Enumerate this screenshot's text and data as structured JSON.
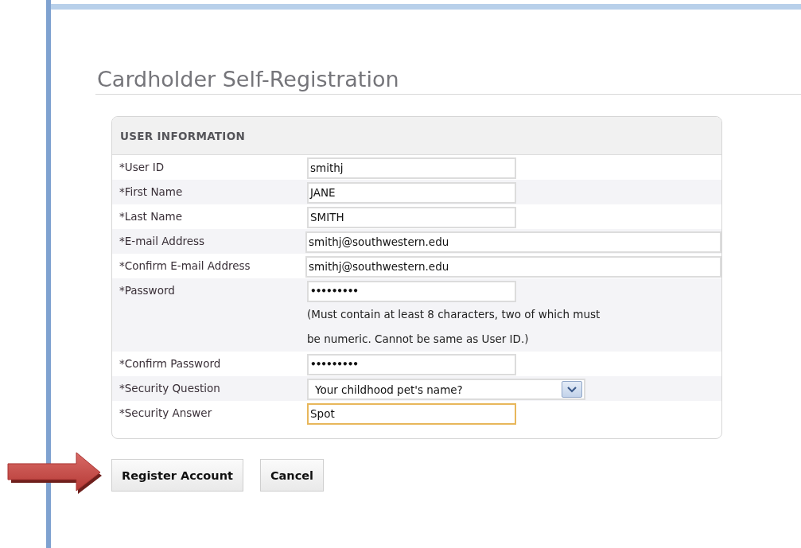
{
  "title": "Cardholder Self-Registration",
  "section": {
    "heading": "USER INFORMATION",
    "fields": [
      {
        "label": "*User ID",
        "kind": "text",
        "value": "smithj",
        "focused": false
      },
      {
        "label": "*First Name",
        "kind": "text",
        "value": "JANE",
        "focused": false
      },
      {
        "label": "*Last Name",
        "kind": "text",
        "value": "SMITH",
        "focused": false
      },
      {
        "label": "*E-mail Address",
        "kind": "email",
        "value": "smithj@southwestern.edu",
        "focused": false
      },
      {
        "label": "*Confirm E-mail Address",
        "kind": "email",
        "value": "smithj@southwestern.edu",
        "focused": false
      },
      {
        "label": "*Password",
        "kind": "password",
        "value": "•••••••••",
        "focused": false,
        "hint": [
          "(Must contain at least 8 characters, two of which must",
          "be numeric. Cannot be same as User ID.)"
        ]
      },
      {
        "label": "*Confirm Password",
        "kind": "password",
        "value": "•••••••••",
        "focused": false
      },
      {
        "label": "*Security Question",
        "kind": "select",
        "value": "Your childhood pet's name?",
        "focused": false
      },
      {
        "label": "*Security Answer",
        "kind": "text",
        "value": "Spot",
        "focused": true
      }
    ]
  },
  "buttons": [
    "Register Account",
    "Cancel"
  ]
}
